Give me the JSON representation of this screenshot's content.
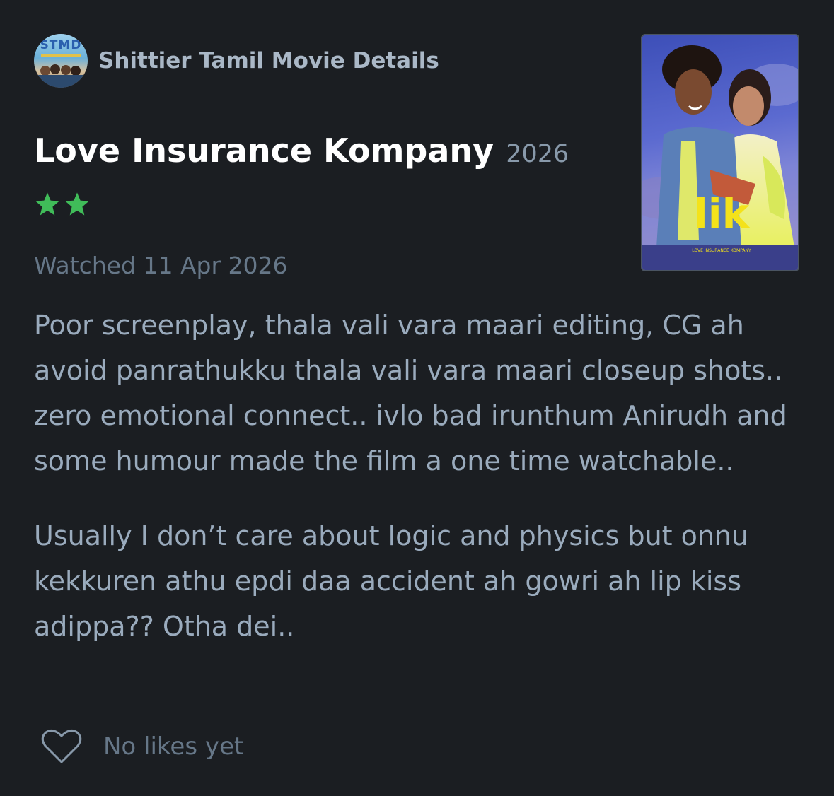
{
  "reviewer": {
    "name": "Shittier Tamil Movie Details",
    "avatar_text": "STMD"
  },
  "film": {
    "title": "Love Insurance Kompany",
    "year": "2026",
    "poster_logo": "lik",
    "poster_subtitle": "LOVE INSURANCE KOMPANY"
  },
  "rating": {
    "stars": 2,
    "max_stars": 5,
    "star_color": "#40bc59"
  },
  "watched": "Watched 11 Apr 2026",
  "review": {
    "paragraphs": [
      "Poor screenplay, thala vali vara maari editing, CG ah avoid panrathukku thala vali vara maari closeup shots.. zero emotional connect.. ivlo bad irunthum Anirudh and some humour made the film a one time watchable..",
      "Usually I don’t care about logic and physics but onnu kekkuren athu epdi daa accident ah gowri ah lip kiss adippa?? Otha dei.."
    ]
  },
  "likes": {
    "text": "No likes yet",
    "icon": "heart-icon"
  },
  "colors": {
    "background": "#1b1e22",
    "text": "#9aabbd",
    "muted": "#667788"
  }
}
